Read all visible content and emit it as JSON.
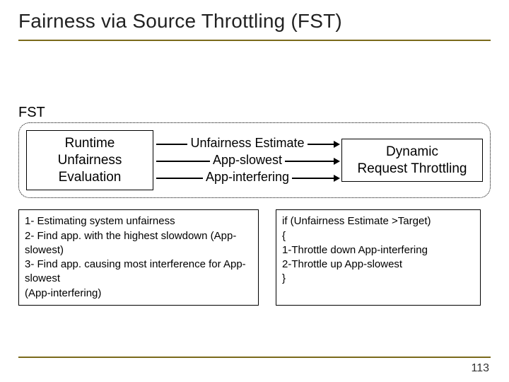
{
  "title": "Fairness via Source Throttling (FST)",
  "fst_label": "FST",
  "runtime_box": "Runtime\nUnfairness\nEvaluation",
  "mid": {
    "ue": "Unfairness Estimate",
    "as": "App-slowest",
    "ai": "App-interfering"
  },
  "dynamic_box": "Dynamic\nRequest Throttling",
  "note_left": "1- Estimating system unfairness\n2- Find app. with the highest slowdown (App-slowest)\n3- Find app. causing most interference for App-slowest\n(App-interfering)",
  "note_right": "if (Unfairness Estimate >Target)\n{\n 1-Throttle down App-interfering\n 2-Throttle up App-slowest\n}",
  "pagenum": "113"
}
